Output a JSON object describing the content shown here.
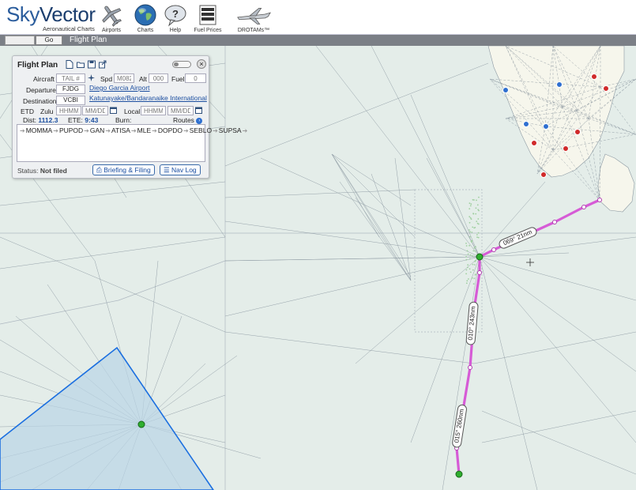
{
  "header": {
    "logo_sky": "Sky",
    "logo_vector": "Vector",
    "logo_sub": "Aeronautical Charts",
    "nav": [
      {
        "label": "Airports",
        "icon": "airplane-icon"
      },
      {
        "label": "Charts",
        "icon": "globe-icon"
      },
      {
        "label": "Help",
        "icon": "help-bubble-icon"
      },
      {
        "label": "Fuel Prices",
        "icon": "fuel-price-icon"
      },
      {
        "label": "DROTAMs™",
        "icon": "drone-icon"
      }
    ]
  },
  "searchbar": {
    "go_label": "Go",
    "flight_plan_label": "Flight Plan"
  },
  "flight_plan": {
    "title": "Flight Plan",
    "aircraft_label": "Aircraft",
    "tail_placeholder": "TAIL #",
    "spd_label": "Spd",
    "spd_placeholder": "M082",
    "alt_label": "Alt",
    "alt_placeholder": "000",
    "fuel_label": "Fuel",
    "fuel_placeholder": "0",
    "departure_label": "Departure",
    "departure_code": "FJDG",
    "departure_name": "Diego Garcia Airport",
    "destination_label": "Destination",
    "destination_code": "VCBI",
    "destination_name": "Katunayake/Bandaranaike International",
    "etd_label": "ETD",
    "zulu_label": "Zulu",
    "local_label": "Local",
    "time_placeholder": "HHMM",
    "date_placeholder": "MM/DD",
    "dist_label": "Dist:",
    "dist_value": "1112.3",
    "ete_label": "ETE:",
    "ete_value": "9:43",
    "burn_label": "Burn:",
    "routes_label": "Routes",
    "route": [
      "MOMMA",
      "PUPOD",
      "GAN",
      "ATISA",
      "MLE",
      "DOPDO",
      "SEBLO",
      "SUPSA"
    ],
    "status_label": "Status:",
    "status_value": "Not filed",
    "briefing_button": "Briefing & Filing",
    "navlog_button": "Nav Log"
  },
  "map": {
    "legs": [
      {
        "label": "069° 21nm"
      },
      {
        "label": "010° 243nm"
      },
      {
        "label": "015° 260nm"
      }
    ],
    "colors": {
      "sea": "#e4ede9",
      "land": "#f6f6ec",
      "route": "#d65bd6",
      "airway": "#6f7d8a",
      "boundary": "#1b6fe0",
      "boundary_fill": "#b9d4e6",
      "airport_green": "#2fae2f",
      "airport_blue": "#2f6fd0",
      "airport_red": "#d02a2a"
    }
  }
}
